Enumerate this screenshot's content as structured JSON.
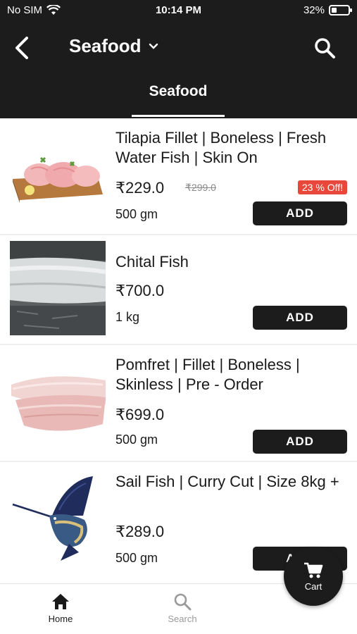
{
  "status_bar": {
    "carrier": "No SIM",
    "time": "10:14 PM",
    "battery": "32%",
    "battery_level": 0.32
  },
  "header": {
    "title": "Seafood",
    "active_tab": "Seafood"
  },
  "products": [
    {
      "name": "Tilapia Fillet | Boneless | Fresh Water Fish | Skin On",
      "price": "₹229.0",
      "old_price": "₹299.0",
      "discount": "23 % Off!",
      "quantity": "500 gm",
      "add_label": "ADD"
    },
    {
      "name": "Chital Fish",
      "price": "₹700.0",
      "quantity": "1 kg",
      "add_label": "ADD"
    },
    {
      "name": "Pomfret | Fillet | Boneless | Skinless | Pre - Order",
      "price": "₹699.0",
      "quantity": "500 gm",
      "add_label": "ADD"
    },
    {
      "name": "Sail Fish | Curry Cut | Size 8kg +",
      "price": "₹289.0",
      "quantity": "500 gm",
      "add_label": "ADD"
    }
  ],
  "bottom_nav": {
    "home_label": "Home",
    "search_label": "Search",
    "cart_label": "Cart"
  },
  "colors": {
    "header_bg": "#1c1c1c",
    "discount_badge": "#e8483b",
    "button_bg": "#1c1c1c"
  }
}
